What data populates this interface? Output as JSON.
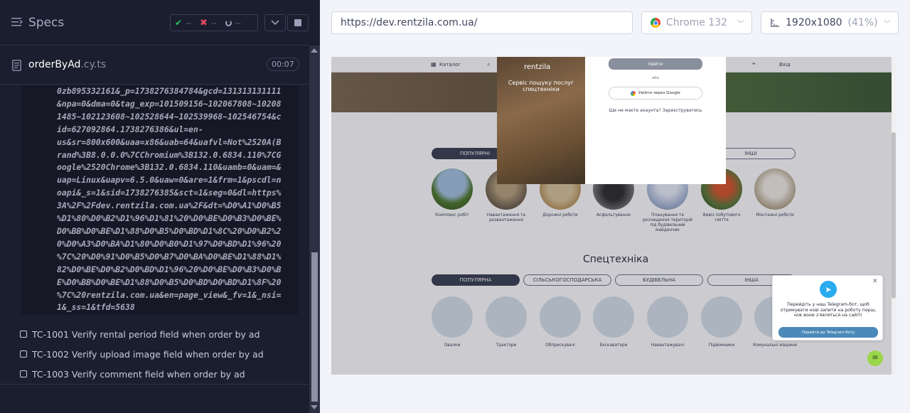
{
  "specs_panel": {
    "title": "Specs",
    "stats": {
      "passed": "--",
      "failed": "--",
      "pending": "--"
    },
    "file": {
      "name": "orderByAd",
      "ext": ".cy.ts",
      "duration": "00:07"
    },
    "log_lines": [
      "0zb895332161&_p=1738276384784&gcd=131313131111",
      "&npa=0&dma=0&tag_exp=101509156~102067808~10208",
      "1485~102123608~102528644~102539968~102546754&c",
      "id=627092864.1738276386&ul=en-",
      "us&sr=800x600&uaa=x86&uab=64&uafvl=Not%2520A(B",
      "rand%3B8.0.0.0%7CChromium%3B132.0.6834.110%7CG",
      "oogle%2520Chrome%3B132.0.6834.110&uamb=0&uam=&",
      "uap=Linux&uapv=6.5.0&uaw=0&are=1&frm=1&pscdl=n",
      "oapi&_s=1&sid=1738276385&sct=1&seg=0&dl=https%",
      "3A%2F%2Fdev.rentzila.com.ua%2F&dt=%D0%A1%D0%B5",
      "%D1%80%D0%B2%D1%96%D1%81%20%D0%BE%D0%B3%D0%BE%",
      "D0%BB%D0%BE%D1%88%D0%B5%D0%BD%D1%8C%20%D0%B2%2",
      "0%D0%A3%D0%BA%D1%80%D0%B0%D1%97%D0%BD%D1%96%20",
      "%7C%20%D0%91%D0%B5%D0%B7%D0%BA%D0%BE%D1%88%D1%",
      "82%D0%BE%D0%B2%D0%BD%D1%96%20%D0%BE%D0%B3%D0%B",
      "E%D0%BB%D0%BE%D1%88%D0%B5%D0%BD%D0%BD%D1%8F%20",
      "%7C%20rentzila.com.ua&en=page_view&_fv=1&_nsi=",
      "1&_ss=1&tfd=5638"
    ],
    "tests": [
      "TC-1001 Verify rental period field when order by ad",
      "TC-1002 Verify upload image field when order by ad",
      "TC-1003 Verify comment field when order by ad"
    ]
  },
  "aut_header": {
    "url": "https://dev.rentzila.com.ua/",
    "browser": "Chrome 132",
    "viewport": "1920x1080",
    "viewport_pct": "(41%)"
  },
  "site": {
    "nav_catalog": "Каталог",
    "nav_login": "Вхід",
    "service_tabs": [
      "ПОПУЛЯРНІ",
      "ІНШІ"
    ],
    "services": [
      "Комплекс робіт",
      "Навантаження та розвантаження",
      "Дорожні роботи",
      "Асфальтування",
      "Планування та розчищення територій під будівельний майданчик",
      "Вивіз побутового сміття",
      "Монтажні роботи"
    ],
    "equipment_title": "Спецтехніка",
    "equipment_tabs": [
      "ПОПУЛЯРНА",
      "СІЛЬСЬКОГОСПОДАРСЬКА",
      "БУДІВЕЛЬНА",
      "ІНША"
    ],
    "equipment": [
      "Овалки",
      "Трактори",
      "Обприскувачі",
      "Екскаватори",
      "Навантажувачі",
      "Підйомники",
      "Комунальні машини"
    ],
    "modal": {
      "logo": "rentzila",
      "tagline": "Сервіс пошуку послуг спецтехніки",
      "login_label": "Увійти",
      "or_label": "або",
      "google_label": "Увійти через Google",
      "signup_text": "Ще не маєте акаунта? Зареєструватись"
    },
    "telegram": {
      "text": "Перейдіть у наш Telegram-бот, щоб отримувати нові запити на роботу перш, ніж вони з'являться на сайті!",
      "button": "Перейти до Telegram-боту"
    }
  }
}
